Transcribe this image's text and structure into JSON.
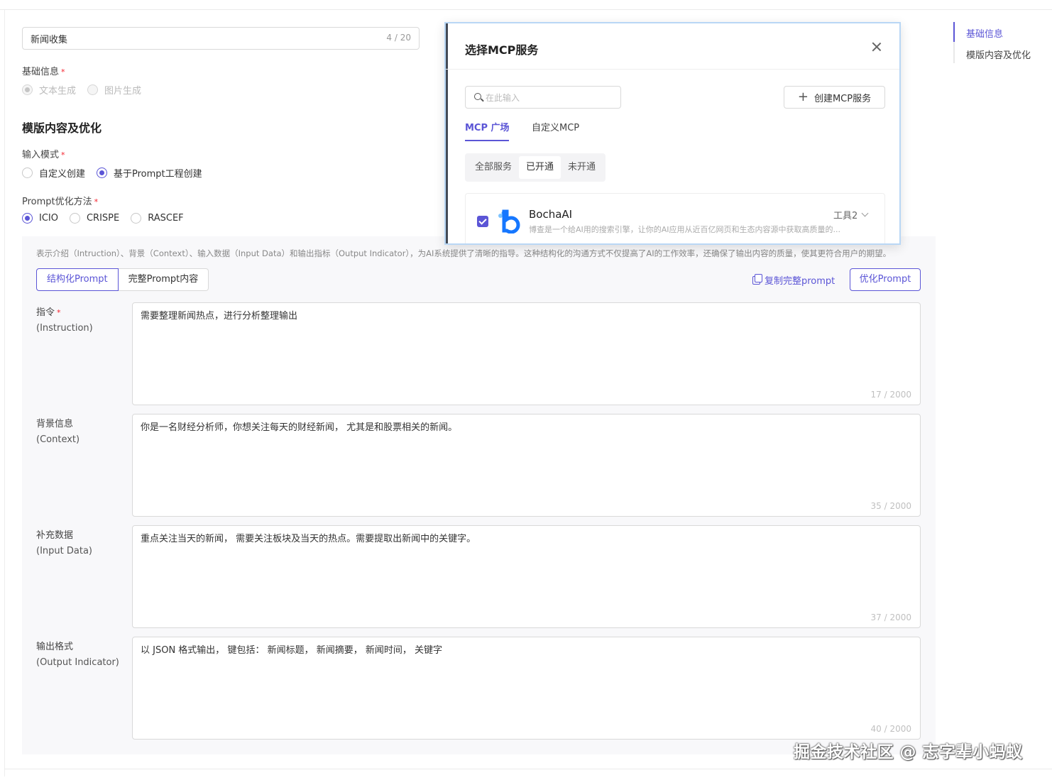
{
  "form": {
    "name_value": "新闻收集",
    "name_count": "4 / 20",
    "basic_info_label": "基础信息",
    "required_mark": "*",
    "basic_options": [
      "文本生成",
      "图片生成"
    ],
    "section_title": "模版内容及优化",
    "input_mode_label": "输入模式",
    "input_mode_options": [
      "自定义创建",
      "基于Prompt工程创建"
    ],
    "input_mode_selected": "基于Prompt工程创建",
    "prompt_method_label": "Prompt优化方法",
    "prompt_method_options": [
      "ICIO",
      "CRISPE",
      "RASCEF"
    ],
    "prompt_method_selected": "ICIO"
  },
  "panel": {
    "description": "表示介绍（Intruction）、背景（Context）、输入数据（Input Data）和输出指标（Output Indicator），为AI系统提供了清晰的指导。这种结构化的沟通方式不仅提高了AI的工作效率，还确保了输出内容的质量，使其更符合用户的期望。",
    "tab_structured": "结构化Prompt",
    "tab_full": "完整Prompt内容",
    "copy_label": "复制完整prompt",
    "optimize_label": "优化Prompt",
    "fields": [
      {
        "label": "指令",
        "required": true,
        "sub": "(Instruction)",
        "value": "需要整理新闻热点，进行分析整理输出",
        "count": "17 / 2000"
      },
      {
        "label": "背景信息",
        "required": false,
        "sub": "(Context)",
        "value": "你是一名财经分析师，你想关注每天的财经新闻， 尤其是和股票相关的新闻。",
        "count": "35 / 2000"
      },
      {
        "label": "补充数据",
        "required": false,
        "sub": "(Input Data)",
        "value": "重点关注当天的新闻， 需要关注板块及当天的热点。需要提取出新闻中的关键字。",
        "count": "37 / 2000"
      },
      {
        "label": "输出格式",
        "required": false,
        "sub": "(Output Indicator)",
        "value": "以 JSON 格式输出， 键包括： 新闻标题， 新闻摘要， 新闻时间，  关键字",
        "count": "40 / 2000"
      }
    ]
  },
  "anchor": {
    "items": [
      "基础信息",
      "模版内容及优化"
    ],
    "active": "基础信息"
  },
  "modal": {
    "title": "选择MCP服务",
    "search_placeholder": "在此输入",
    "create_label": "创建MCP服务",
    "tabs": [
      "MCP 广场",
      "自定义MCP"
    ],
    "active_tab": "MCP 广场",
    "filters": [
      "全部服务",
      "已开通",
      "未开通"
    ],
    "active_filter": "已开通",
    "card": {
      "checked": true,
      "name": "BochaAI",
      "tools": "工具2",
      "description": "博查是一个给AI用的搜索引擎，让你的AI应用从近百亿网页和生态内容源中获取高质量的..."
    }
  },
  "watermark": "掘金技术社区 @ 志字辈小蚂蚁",
  "colors": {
    "accent": "#5b55d6",
    "required": "#f5222d",
    "brand_logo": "#1677ff"
  }
}
